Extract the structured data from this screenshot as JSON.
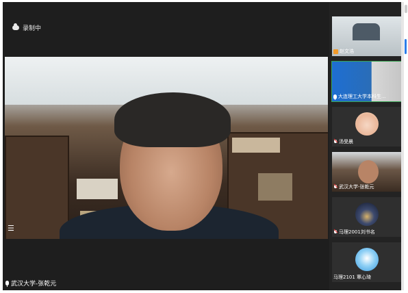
{
  "recording": {
    "icon": "cloud-recording-icon",
    "label": "录制中"
  },
  "main_speaker": {
    "name": "武汉大学-张乾元",
    "icon": "microphone-icon"
  },
  "menu_icon": "list-menu-icon",
  "participants": [
    {
      "name": "赵文浩",
      "icon": "person-avatar-icon",
      "active": false
    },
    {
      "name": "大连理工大学本科生...",
      "icon": "microphone-icon",
      "active": true
    },
    {
      "name": "汤旻晨",
      "icon": "microphone-muted-icon",
      "active": false
    },
    {
      "name": "武汉大学-张乾元",
      "icon": "microphone-muted-icon",
      "active": false
    },
    {
      "name": "马理2001刘书名",
      "icon": "microphone-muted-icon",
      "active": false
    },
    {
      "name": "马理2101 覃心琦",
      "icon": "",
      "active": false
    }
  ],
  "colors": {
    "accent": "#2b7de9",
    "active_border": "#3aa655",
    "background": "#232323"
  }
}
